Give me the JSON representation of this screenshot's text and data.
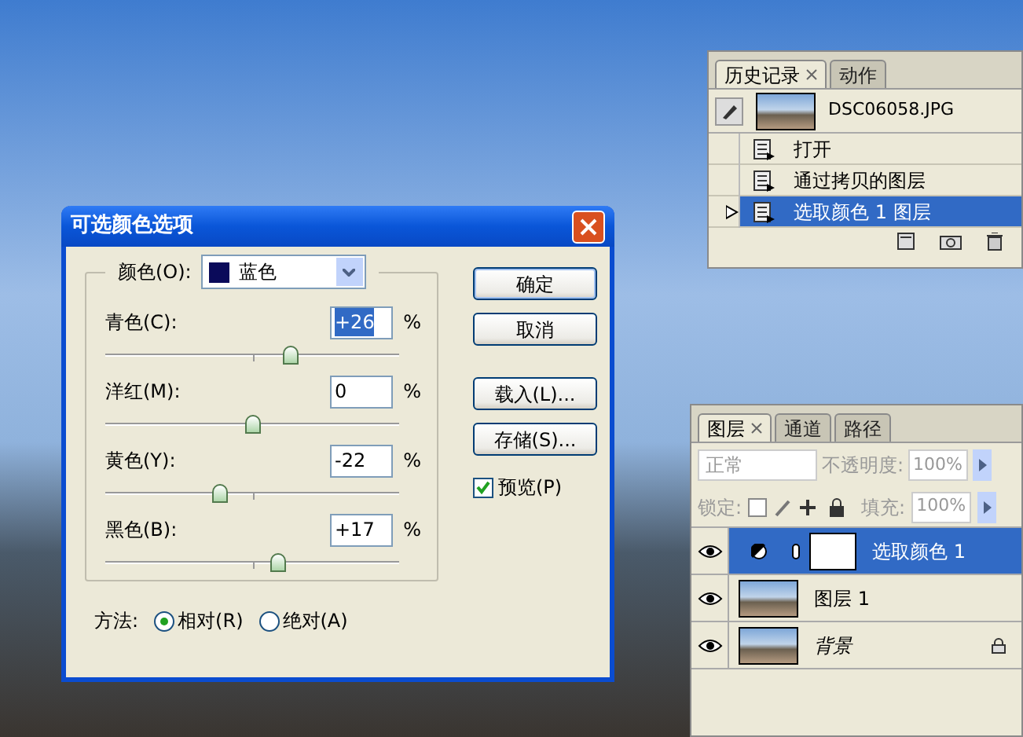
{
  "history_panel": {
    "tabs": [
      {
        "label": "历史记录",
        "selected": true,
        "closable": true
      },
      {
        "label": "动作",
        "selected": false,
        "closable": false
      }
    ],
    "snapshot": {
      "label": "DSC06058.JPG"
    },
    "items": [
      {
        "label": "打开",
        "selected": false
      },
      {
        "label": "通过拷贝的图层",
        "selected": false
      },
      {
        "label": "选取颜色 1 图层",
        "selected": true
      }
    ]
  },
  "dialog": {
    "title": "可选颜色选项",
    "color_label": "颜色(O):",
    "color_value": "蓝色",
    "sliders": [
      {
        "label": "青色(C):",
        "value": "+26",
        "unit": "%",
        "level": 0.63,
        "focused": true
      },
      {
        "label": "洋红(M):",
        "value": "0",
        "unit": "%",
        "level": 0.5,
        "focused": false
      },
      {
        "label": "黄色(Y):",
        "value": "-22",
        "unit": "%",
        "level": 0.39,
        "focused": false
      },
      {
        "label": "黑色(B):",
        "value": "+17",
        "unit": "%",
        "level": 0.59,
        "focused": false
      }
    ],
    "buttons": [
      {
        "label": "确定",
        "default": true
      },
      {
        "label": "取消",
        "default": false
      },
      {
        "label": "载入(L)...",
        "default": false
      },
      {
        "label": "存储(S)...",
        "default": false
      }
    ],
    "preview": {
      "label": "预览(P)",
      "checked": true
    },
    "method": {
      "label": "方法:",
      "options": [
        {
          "label": "相对(R)",
          "selected": true
        },
        {
          "label": "绝对(A)",
          "selected": false
        }
      ]
    }
  },
  "layers_panel": {
    "tabs": [
      {
        "label": "图层",
        "selected": true,
        "closable": true
      },
      {
        "label": "通道",
        "selected": false,
        "closable": false
      },
      {
        "label": "路径",
        "selected": false,
        "closable": false
      }
    ],
    "blend_mode": "正常",
    "opacity_label": "不透明度:",
    "opacity": "100%",
    "lock_label": "锁定:",
    "fill_label": "填充:",
    "fill": "100%",
    "layers": [
      {
        "name": "选取颜色 1",
        "kind": "adjustment",
        "selected": true,
        "visible": true,
        "locked": false
      },
      {
        "name": "图层 1",
        "kind": "image",
        "selected": false,
        "visible": true,
        "locked": false
      },
      {
        "name": "背景",
        "kind": "image",
        "selected": false,
        "visible": true,
        "locked": true
      }
    ]
  }
}
